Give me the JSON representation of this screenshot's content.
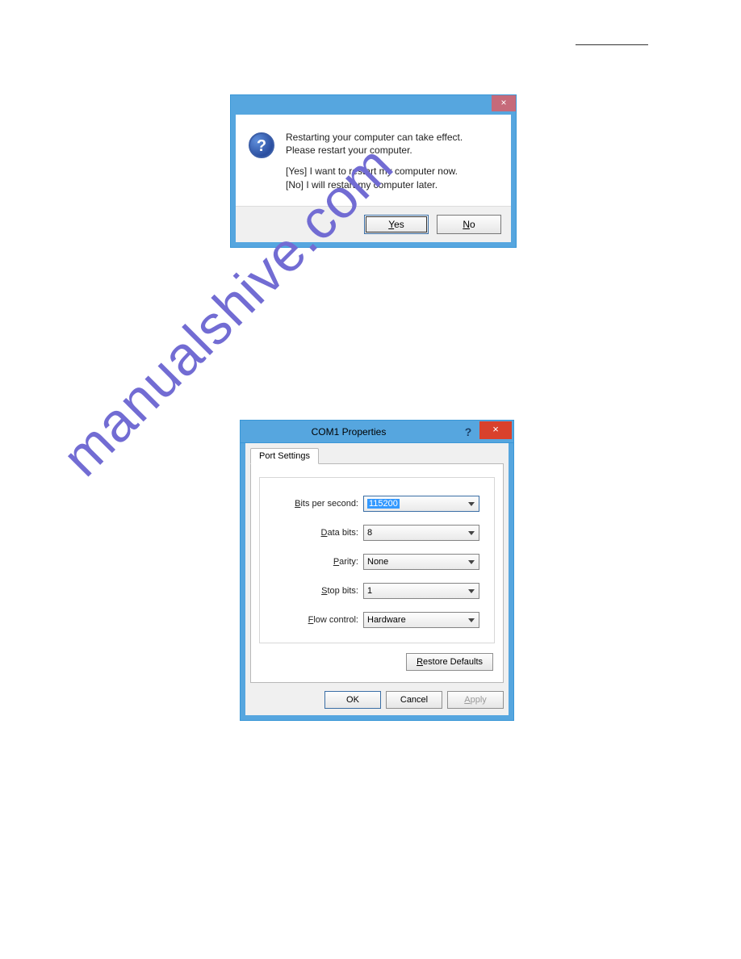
{
  "page": {
    "watermark": "manualshive.com"
  },
  "dlg1": {
    "line1": "Restarting your computer can take effect.",
    "line2": "Please restart your computer.",
    "opt_yes": "[Yes] I want to restart my computer now.",
    "opt_no": "[No] I will restart my computer later.",
    "btn_yes_u": "Y",
    "btn_yes_rest": "es",
    "btn_no_u": "N",
    "btn_no_rest": "o",
    "close_glyph": "×"
  },
  "dlg2": {
    "title": "COM1 Properties",
    "help_glyph": "?",
    "close_glyph": "×",
    "tab_label": "Port Settings",
    "fields": {
      "bits_per_second": {
        "label_u": "B",
        "label_rest": "its per second:",
        "value": "115200"
      },
      "data_bits": {
        "label_u": "D",
        "label_rest": "ata bits:",
        "value": "8"
      },
      "parity": {
        "label_u": "P",
        "label_rest": "arity:",
        "value": "None"
      },
      "stop_bits": {
        "label_u": "S",
        "label_rest": "top bits:",
        "value": "1"
      },
      "flow_control": {
        "label_u": "F",
        "label_rest": "low control:",
        "value": "Hardware"
      }
    },
    "restore_u": "R",
    "restore_rest": "estore Defaults",
    "btn_ok": "OK",
    "btn_cancel": "Cancel",
    "btn_apply_u": "A",
    "btn_apply_rest": "pply"
  }
}
